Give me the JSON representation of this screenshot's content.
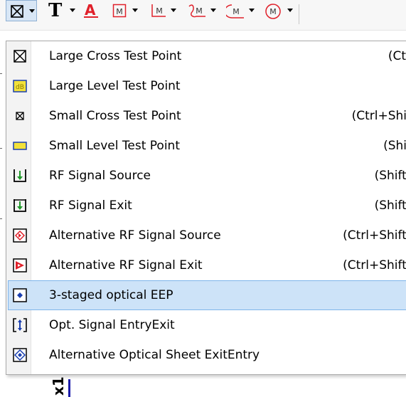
{
  "toolbar": {
    "buttons": [
      {
        "icon": "cross-box-icon",
        "has_dropdown": true,
        "active": true
      },
      {
        "icon": "text-t-icon",
        "has_dropdown": true
      },
      {
        "icon": "red-a-text-icon",
        "has_dropdown": false
      },
      {
        "icon": "m-box-icon",
        "has_dropdown": true
      },
      {
        "icon": "m-line-icon",
        "has_dropdown": true
      },
      {
        "icon": "m-curve-icon",
        "has_dropdown": true
      },
      {
        "icon": "m-arc-icon",
        "has_dropdown": true
      },
      {
        "icon": "m-circle-icon",
        "has_dropdown": true
      }
    ],
    "m_letter": "M"
  },
  "menu": {
    "items": [
      {
        "label": "Large Cross Test Point",
        "shortcut": "(Ctr",
        "icon": "large-cross-icon"
      },
      {
        "label": "Large Level Test Point",
        "shortcut": "",
        "icon": "large-level-icon"
      },
      {
        "label": "Small Cross Test Point",
        "shortcut": "(Ctrl+Shif",
        "icon": "small-cross-icon"
      },
      {
        "label": "Small Level Test Point",
        "shortcut": "(Shif",
        "icon": "small-level-icon"
      },
      {
        "label": "RF Signal Source",
        "shortcut": "(Shift-",
        "icon": "rf-source-icon"
      },
      {
        "label": "RF Signal Exit",
        "shortcut": "(Shift-",
        "icon": "rf-exit-icon"
      },
      {
        "label": "Alternative RF Signal Source",
        "shortcut": "(Ctrl+Shift-",
        "icon": "alt-rf-source-icon"
      },
      {
        "label": "Alternative RF Signal Exit",
        "shortcut": "(Ctrl+Shift-",
        "icon": "alt-rf-exit-icon"
      },
      {
        "label": "3-staged optical EEP",
        "shortcut": "",
        "icon": "optical-eep-icon",
        "highlighted": true
      },
      {
        "label": "Opt. Signal EntryExit",
        "shortcut": "",
        "icon": "opt-entry-exit-icon"
      },
      {
        "label": "Alternative Optical Sheet ExitEntry",
        "shortcut": "",
        "icon": "alt-optical-sheet-icon"
      }
    ]
  },
  "background_glyph": "x1",
  "colors": {
    "highlight_bg": "#cde3f8",
    "highlight_border": "#7eb4ea",
    "yellow": "#f2e13a",
    "green": "#1f9a2a",
    "red": "#e0202a",
    "blue": "#1a3fb0"
  }
}
